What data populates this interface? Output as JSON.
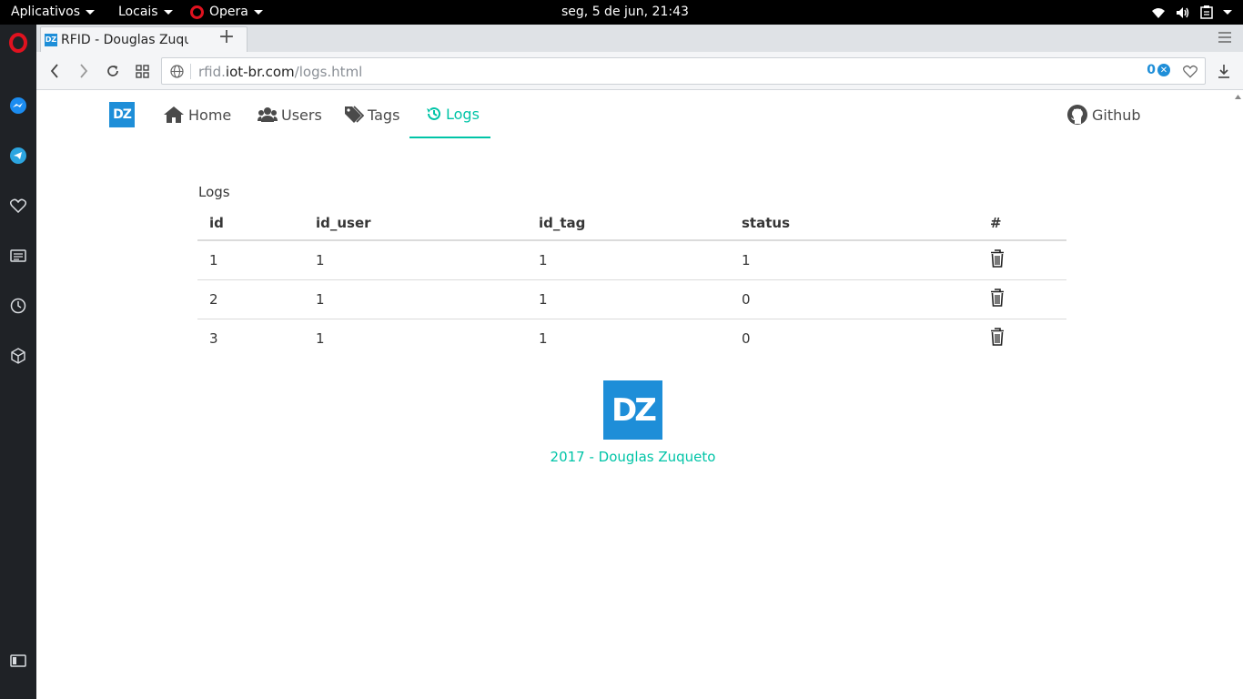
{
  "system_bar": {
    "applications": "Aplicativos",
    "places": "Locais",
    "browser": "Opera",
    "clock": "seg,  5 de jun, 21:43",
    "icons": [
      "wifi-icon",
      "volume-icon",
      "clipboard-icon",
      "power-icon"
    ]
  },
  "browser": {
    "tab_title": "RFID - Douglas Zuqueto",
    "favicon": "DZ",
    "url": {
      "subdomain": "rfid.",
      "domain": "iot-br.com",
      "path": "/logs.html"
    },
    "adblock_count": "0",
    "accent": "#1e8ed8"
  },
  "sidebar": [
    "opera-icon",
    "messenger-icon",
    "telegram-icon",
    "heart-icon",
    "news-icon",
    "history-icon",
    "extensions-icon",
    "sidebar-toggle-icon"
  ],
  "page": {
    "logo": "DZ",
    "nav": {
      "home": "Home",
      "users": "Users",
      "tags": "Tags",
      "logs": "Logs",
      "github": "Github"
    },
    "table_caption": "Logs",
    "columns": [
      "id",
      "id_user",
      "id_tag",
      "status",
      "#"
    ],
    "rows": [
      [
        "1",
        "1",
        "1",
        "1"
      ],
      [
        "2",
        "1",
        "1",
        "0"
      ],
      [
        "3",
        "1",
        "1",
        "0"
      ]
    ],
    "footer_logo": "DZ",
    "footer": "2017 - Douglas Zuqueto",
    "accent": "#00c4a7"
  }
}
